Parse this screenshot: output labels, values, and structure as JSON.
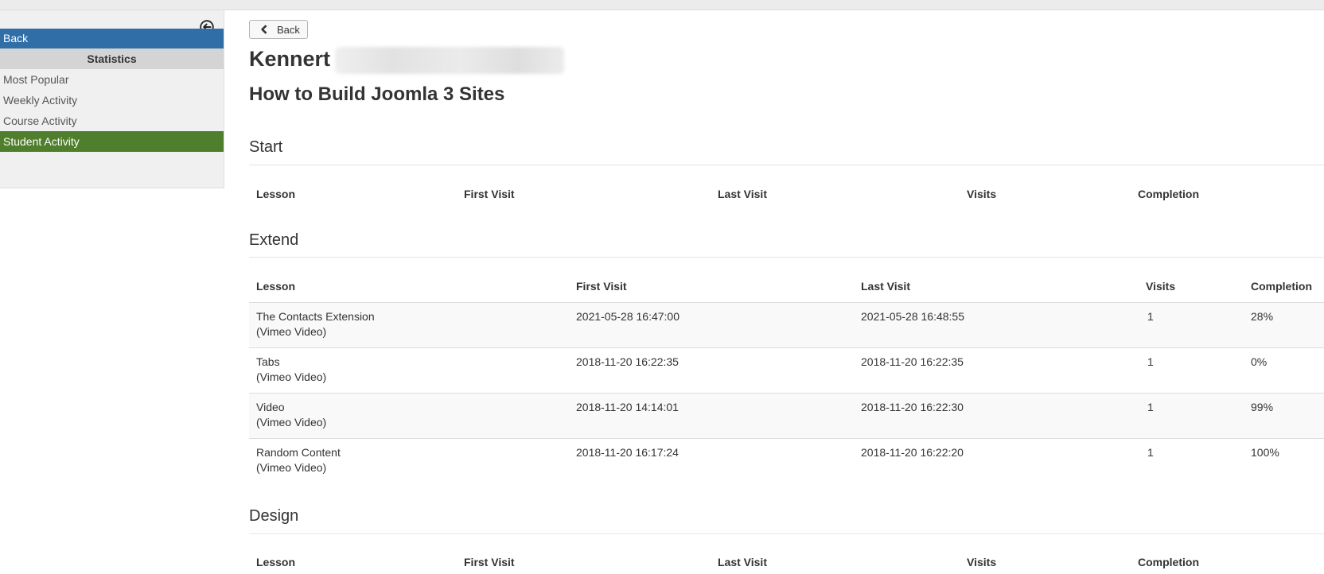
{
  "sidebar": {
    "back_label": "Back",
    "section_header": "Statistics",
    "items": [
      {
        "label": "Most Popular",
        "active": false
      },
      {
        "label": "Weekly Activity",
        "active": false
      },
      {
        "label": "Course Activity",
        "active": false
      },
      {
        "label": "Student Activity",
        "active": true
      }
    ],
    "collapse_icon": "circle-arrow-left-icon"
  },
  "main": {
    "back_button_label": "Back",
    "back_icon": "chevron-left-icon",
    "student_name": "Kennert",
    "course_title": "How to Build Joomla 3 Sites",
    "sections": [
      {
        "title": "Start",
        "headers": [
          "Lesson",
          "First Visit",
          "Last Visit",
          "Visits",
          "Completion"
        ],
        "rows": []
      },
      {
        "title": "Extend",
        "headers": [
          "Lesson",
          "First Visit",
          "Last Visit",
          "Visits",
          "Completion"
        ],
        "rows": [
          {
            "lesson": "The Contacts Extension",
            "type": "(Vimeo Video)",
            "first_visit": "2021-05-28 16:47:00",
            "last_visit": "2021-05-28 16:48:55",
            "visits": "1",
            "completion": "28%"
          },
          {
            "lesson": "Tabs",
            "type": "(Vimeo Video)",
            "first_visit": "2018-11-20 16:22:35",
            "last_visit": "2018-11-20 16:22:35",
            "visits": "1",
            "completion": "0%"
          },
          {
            "lesson": "Video",
            "type": "(Vimeo Video)",
            "first_visit": "2018-11-20 14:14:01",
            "last_visit": "2018-11-20 16:22:30",
            "visits": "1",
            "completion": "99%"
          },
          {
            "lesson": "Random Content",
            "type": "(Vimeo Video)",
            "first_visit": "2018-11-20 16:17:24",
            "last_visit": "2018-11-20 16:22:20",
            "visits": "1",
            "completion": "100%"
          }
        ]
      },
      {
        "title": "Design",
        "headers": [
          "Lesson",
          "First Visit",
          "Last Visit",
          "Visits",
          "Completion"
        ],
        "rows": []
      }
    ]
  },
  "colors": {
    "sidebar_back_bg": "#2f6ea7",
    "sidebar_active_bg": "#4f7e2c",
    "sidebar_header_bg": "#d4d4d4",
    "sidebar_bg": "#f0f0f0"
  }
}
